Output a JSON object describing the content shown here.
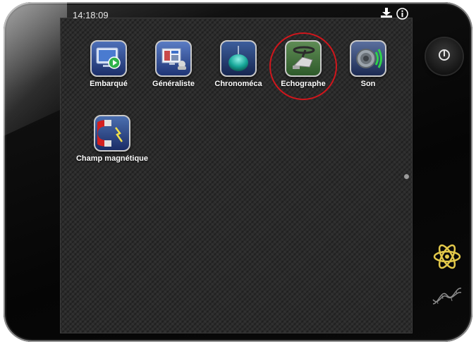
{
  "status_bar": {
    "time": "14:18:09",
    "icons": [
      "download-icon",
      "info-icon"
    ]
  },
  "apps": [
    {
      "label": "Embarqué",
      "icon": "monitor-play-icon",
      "highlighted": false
    },
    {
      "label": "Généraliste",
      "icon": "computer-display-icon",
      "highlighted": false
    },
    {
      "label": "Chronoméca",
      "icon": "pendulum-icon",
      "highlighted": false
    },
    {
      "label": "Echographe",
      "icon": "ultrasound-probe-icon",
      "highlighted": true
    },
    {
      "label": "Son",
      "icon": "speaker-waves-icon",
      "highlighted": false
    },
    {
      "label": "Champ magnétique",
      "icon": "magnet-icon",
      "highlighted": false
    }
  ],
  "side_controls": {
    "power": "power-icon",
    "physics": "atom-icon",
    "biology": "dna-icon"
  },
  "pager": {
    "pages": 1,
    "current": 1
  },
  "colors": {
    "highlight_ring": "#d0161c",
    "atom": "#e2c84a"
  }
}
